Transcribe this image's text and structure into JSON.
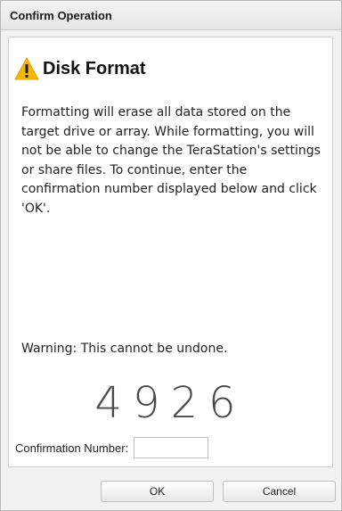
{
  "dialog": {
    "title": "Confirm Operation",
    "heading": "Disk Format",
    "message": "Formatting will erase all data stored on the target drive or array. While formatting, you will not be able to change the TeraStation's settings or share files. To continue, enter the confirmation number displayed below and click 'OK'.",
    "warning": "Warning: This cannot be undone.",
    "confirmation_code": "4926",
    "confirmation_label": "Confirmation Number:",
    "confirmation_value": "",
    "ok_label": "OK",
    "cancel_label": "Cancel"
  },
  "icons": {
    "heading_icon": "warning-triangle-icon"
  },
  "colors": {
    "warning_icon": "#f5b800",
    "code_text": "#4a4a4a"
  }
}
